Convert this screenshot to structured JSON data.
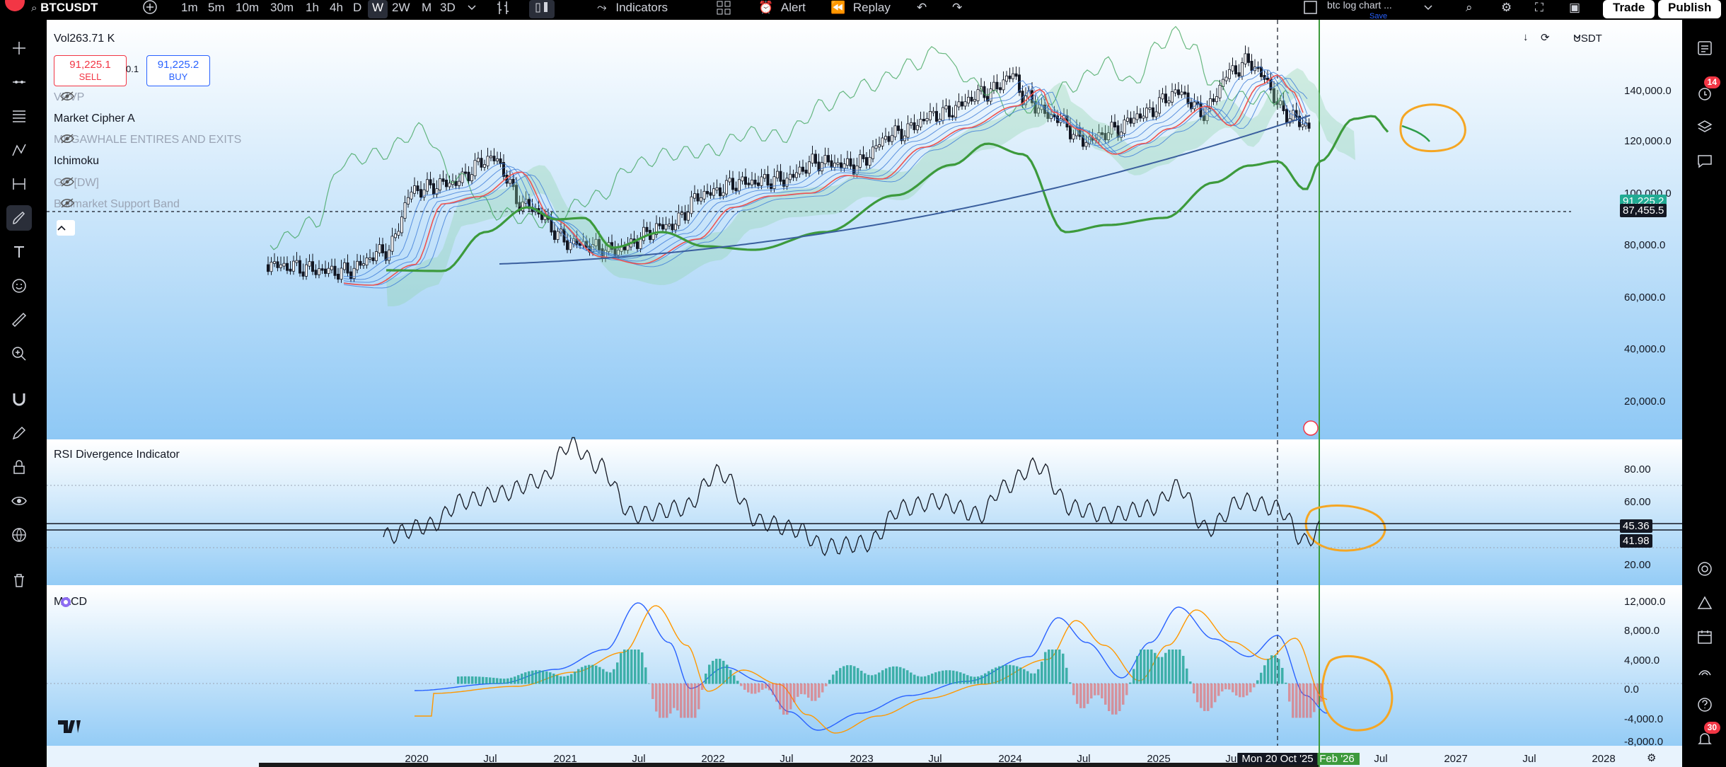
{
  "topbar": {
    "symbol": "BTCUSDT",
    "timeframes": [
      "1m",
      "5m",
      "10m",
      "30m",
      "1h",
      "4h",
      "D",
      "W",
      "2W",
      "M",
      "3D"
    ],
    "active_timeframe": "W",
    "indicators_label": "Indicators",
    "alert_label": "Alert",
    "replay_label": "Replay",
    "layout_name": "btc log chart ...",
    "layout_status": "Save",
    "trade_label": "Trade",
    "publish_label": "Publish"
  },
  "legend": {
    "volume": "Vol263.71 K",
    "sell_price": "91,225.1",
    "sell_label": "SELL",
    "spread": "0.1",
    "buy_price": "91,225.2",
    "buy_label": "BUY",
    "indicators": [
      {
        "name": "VRVP",
        "hidden": true
      },
      {
        "name": "Market Cipher A",
        "hidden": false
      },
      {
        "name": "MEGAWHALE ENTIRES AND EXITS",
        "hidden": true
      },
      {
        "name": "Ichimoku",
        "hidden": false
      },
      {
        "name": "GC [DW]",
        "hidden": true
      },
      {
        "name": "Bullmarket Support Band",
        "hidden": true
      }
    ],
    "rsi_title": "RSI Divergence Indicator",
    "macd_title": "MACD"
  },
  "price_axis": {
    "currency": "USDT",
    "labels": [
      "140,000.0",
      "120,000.0",
      "100,000.0",
      "80,000.0",
      "60,000.0",
      "40,000.0",
      "20,000.0"
    ],
    "current_price": "87,455.5",
    "last_price_partial": "91,225.2"
  },
  "rsi_axis": {
    "labels": [
      "80.00",
      "60.00",
      "20.00"
    ],
    "value1": "45.36",
    "value2": "41.98"
  },
  "macd_axis": {
    "labels": [
      "12,000.0",
      "8,000.0",
      "4,000.0",
      "0.0",
      "-4,000.0",
      "-8,000.0"
    ]
  },
  "time_axis": {
    "labels": [
      "2020",
      "Jul",
      "2021",
      "Jul",
      "2022",
      "Jul",
      "2023",
      "Jul",
      "2024",
      "Jul",
      "2025",
      "Jul",
      "Feb '26",
      "Jul",
      "2027",
      "Jul",
      "2028"
    ],
    "crosshair_label": "Mon 20 Oct '25"
  },
  "right_toolbar": {
    "alerts_badge": "14",
    "notifications_badge": "30"
  },
  "colors": {
    "chart_bg_top": "#ffffff",
    "chart_bg_bottom": "#8ec8f5",
    "green": "#26a69a",
    "red": "#ef5350",
    "annotation": "#f5a623",
    "bull_band": "#3c9a3c"
  }
}
